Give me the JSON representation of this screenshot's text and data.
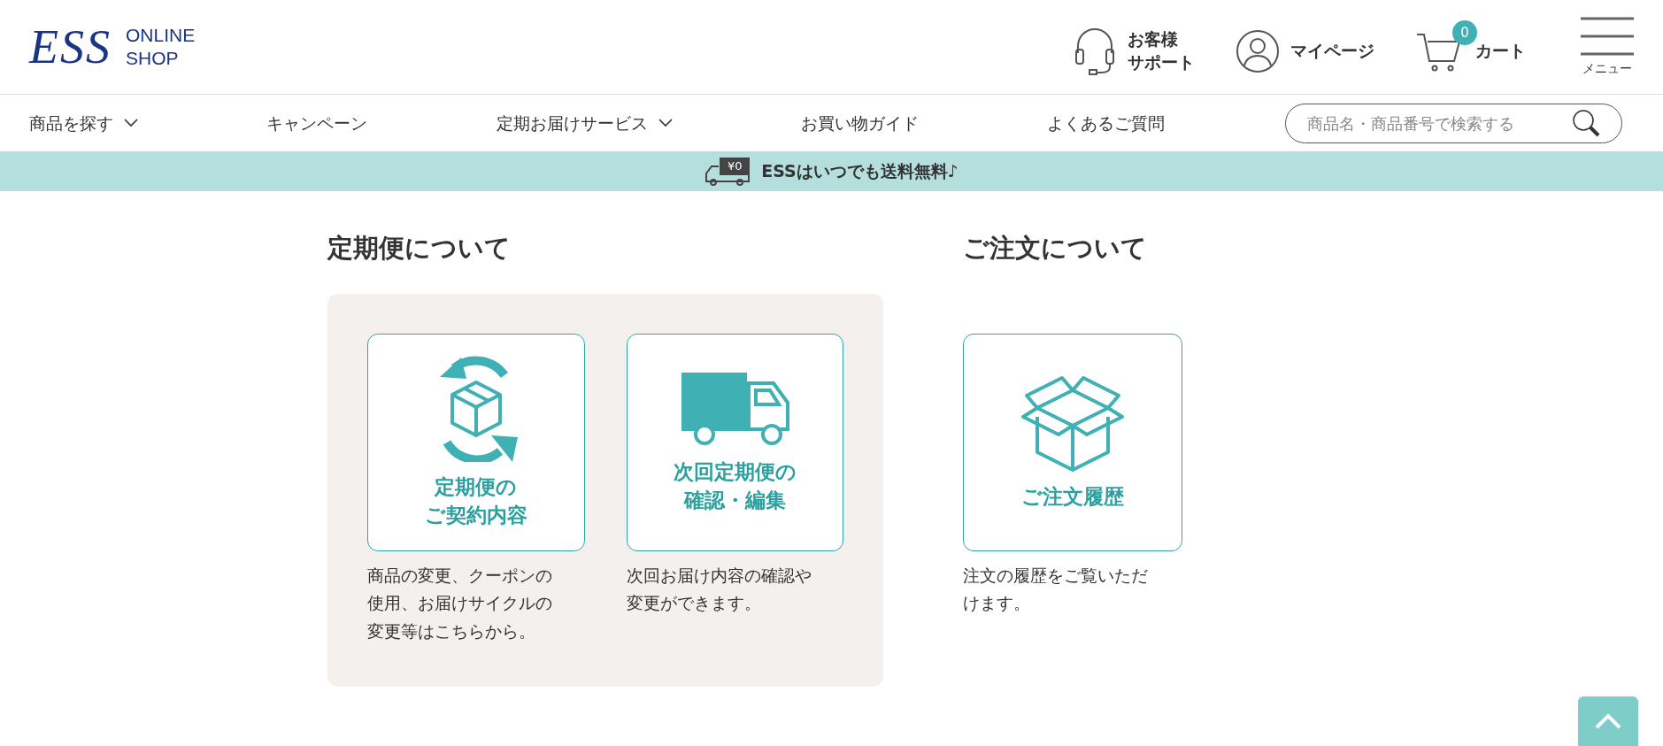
{
  "header": {
    "logo": {
      "mark": "ESS",
      "line1": "ONLINE",
      "line2": "SHOP"
    },
    "actions": [
      {
        "kind": "support",
        "lines": [
          "お客様",
          "サポート"
        ]
      },
      {
        "kind": "mypage",
        "lines": [
          "マイページ"
        ]
      },
      {
        "kind": "cart",
        "lines": [
          "カート"
        ],
        "badge": "0"
      }
    ],
    "menu_label": "メニュー"
  },
  "nav": {
    "items": [
      {
        "label": "商品を探す",
        "dropdown": true
      },
      {
        "label": "キャンペーン",
        "dropdown": false
      },
      {
        "label": "定期お届けサービス",
        "dropdown": true
      },
      {
        "label": "お買い物ガイド",
        "dropdown": false
      },
      {
        "label": "よくあるご質問",
        "dropdown": false
      }
    ],
    "search": {
      "placeholder": "商品名・商品番号で検索する"
    }
  },
  "banner": {
    "price_tag": "¥0",
    "text": "ESSはいつでも送料無料♪"
  },
  "sections": [
    {
      "title": "定期便について",
      "panel": true,
      "cards": [
        {
          "kind": "cycle",
          "title_lines": [
            "定期便の",
            "ご契約内容"
          ],
          "description": "商品の変更、クーポンの使用、お届けサイクルの変更等はこちらから。"
        },
        {
          "kind": "truck",
          "title_lines": [
            "次回定期便の",
            "確認・編集"
          ],
          "description": "次回お届け内容の確認や変更ができます。"
        }
      ]
    },
    {
      "title": "ご注文について",
      "panel": false,
      "cards": [
        {
          "kind": "box",
          "title_lines": [
            "ご注文履歴"
          ],
          "description": "注文の履歴をご覧いただけます。"
        }
      ]
    }
  ]
}
